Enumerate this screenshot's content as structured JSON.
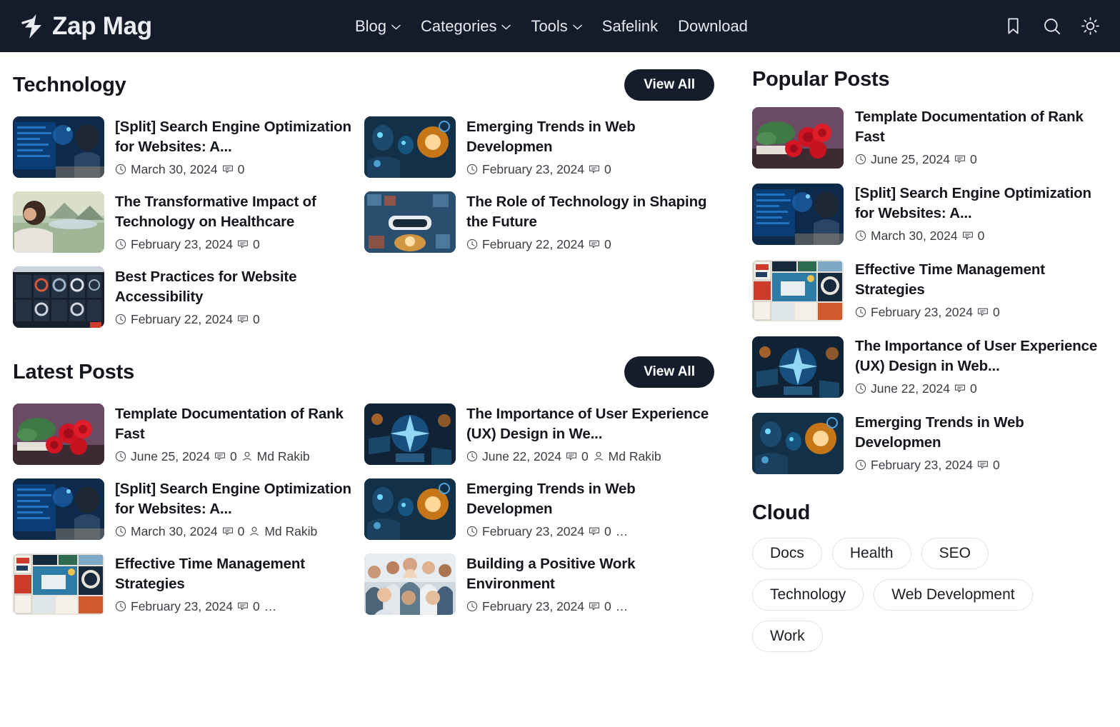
{
  "header": {
    "brand": "Zap Mag",
    "logo_icon": "lightning-bolt-icon",
    "nav": [
      {
        "label": "Blog",
        "has_dropdown": true
      },
      {
        "label": "Categories",
        "has_dropdown": true
      },
      {
        "label": "Tools",
        "has_dropdown": true
      },
      {
        "label": "Safelink",
        "has_dropdown": false
      },
      {
        "label": "Download",
        "has_dropdown": false
      }
    ],
    "icons": [
      "bookmark-icon",
      "search-icon",
      "theme-toggle-sun-icon"
    ],
    "background_color": "#141b2b",
    "text_color": "#e7e9ee"
  },
  "sections": [
    {
      "title": "Technology",
      "view_all_label": "View All",
      "posts": [
        {
          "title": "[Split] Search Engine Optimization for Websites: A...",
          "date": "March 30, 2024",
          "comments": "0",
          "author": "",
          "truncated": false,
          "thumb": "developer-at-monitors"
        },
        {
          "title": "Emerging Trends in Web Developmen",
          "date": "February 23, 2024",
          "comments": "0",
          "author": "",
          "truncated": false,
          "thumb": "robot-at-computer"
        },
        {
          "title": "The Transformative Impact of Technology on Healthcare",
          "date": "February 23, 2024",
          "comments": "0",
          "author": "",
          "truncated": false,
          "thumb": "woman-outdoors-landscape"
        },
        {
          "title": "The Role of Technology in Shaping the Future",
          "date": "February 22, 2024",
          "comments": "0",
          "author": "",
          "truncated": false,
          "thumb": "vr-headset-collage"
        },
        {
          "title": "Best Practices for Website Accessibility",
          "date": "February 22, 2024",
          "comments": "0",
          "author": "",
          "truncated": false,
          "thumb": "dashboard-grid-screen"
        }
      ]
    },
    {
      "title": "Latest Posts",
      "view_all_label": "View All",
      "posts": [
        {
          "title": "Template Documentation of Rank Fast",
          "date": "June 25, 2024",
          "comments": "0",
          "author": "Md Rakib",
          "truncated": false,
          "thumb": "red-roses-on-book"
        },
        {
          "title": "The Importance of User Experience (UX) Design in We...",
          "date": "June 22, 2024",
          "comments": "0",
          "author": "Md Rakib",
          "truncated": false,
          "thumb": "blue-tech-workspace"
        },
        {
          "title": "[Split] Search Engine Optimization for Websites: A...",
          "date": "March 30, 2024",
          "comments": "0",
          "author": "Md Rakib",
          "truncated": false,
          "thumb": "developer-at-monitors"
        },
        {
          "title": "Emerging Trends in Web Developmen",
          "date": "February 23, 2024",
          "comments": "0",
          "author": "",
          "truncated": true,
          "thumb": "robot-at-computer"
        },
        {
          "title": "Effective Time Management Strategies",
          "date": "February 23, 2024",
          "comments": "0",
          "author": "",
          "truncated": true,
          "thumb": "productivity-poster-collage"
        },
        {
          "title": "Building a Positive Work Environment",
          "date": "February 23, 2024",
          "comments": "0",
          "author": "",
          "truncated": true,
          "thumb": "team-high-five"
        }
      ]
    }
  ],
  "sidebar": {
    "popular": {
      "title": "Popular Posts",
      "posts": [
        {
          "title": "Template Documentation of Rank Fast",
          "date": "June 25, 2024",
          "comments": "0",
          "thumb": "red-roses-on-book"
        },
        {
          "title": "[Split] Search Engine Optimization for Websites: A...",
          "date": "March 30, 2024",
          "comments": "0",
          "thumb": "developer-at-monitors"
        },
        {
          "title": "Effective Time Management Strategies",
          "date": "February 23, 2024",
          "comments": "0",
          "thumb": "productivity-poster-collage"
        },
        {
          "title": "The Importance of User Experience (UX) Design in Web...",
          "date": "June 22, 2024",
          "comments": "0",
          "thumb": "blue-tech-workspace"
        },
        {
          "title": "Emerging Trends in Web Developmen",
          "date": "February 23, 2024",
          "comments": "0",
          "thumb": "robot-at-computer"
        }
      ]
    },
    "cloud": {
      "title": "Cloud",
      "tags": [
        "Docs",
        "Health",
        "SEO",
        "Technology",
        "Web Development",
        "Work"
      ]
    }
  },
  "icons": {
    "date": "clock-icon",
    "comments": "comment-bubble-icon",
    "author": "user-icon"
  }
}
